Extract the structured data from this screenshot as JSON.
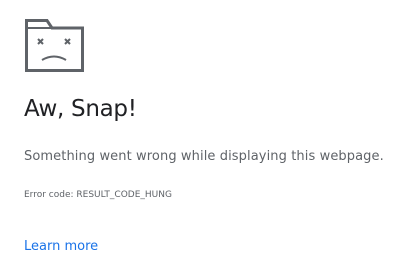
{
  "icon": {
    "name": "sad-tab-icon",
    "color": "#5f6368"
  },
  "error_page": {
    "heading": "Aw, Snap!",
    "message": "Something went wrong while displaying this webpage.",
    "error_code": "Error code: RESULT_CODE_HUNG",
    "learn_more": "Learn more"
  },
  "colors": {
    "heading": "#202124",
    "text": "#5f6368",
    "link": "#1a73e8"
  }
}
